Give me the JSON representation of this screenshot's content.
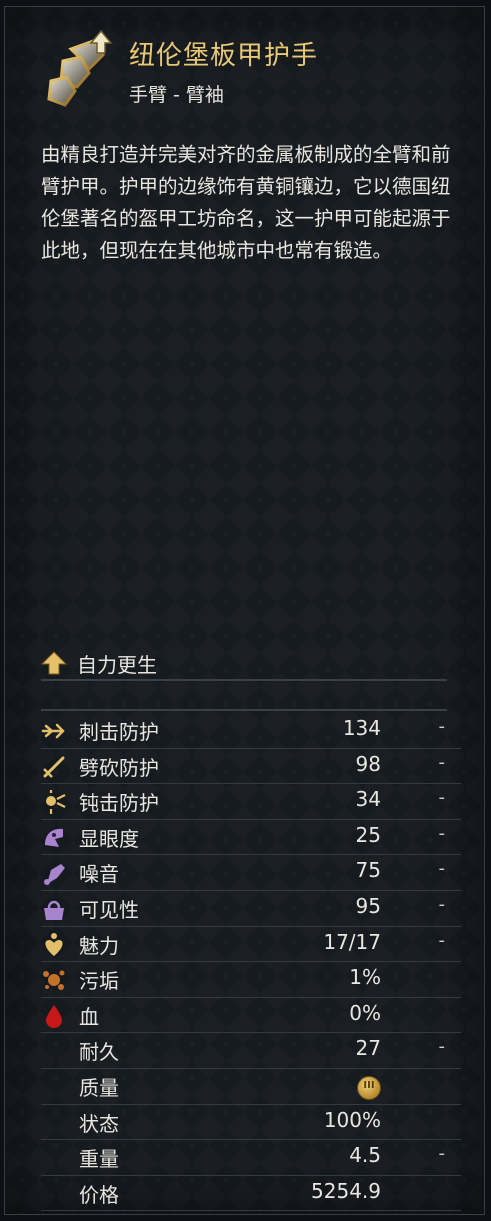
{
  "item": {
    "name": "纽伦堡板甲护手",
    "slot": "手臂 - 臂袖",
    "description": "由精良打造并完美对齐的金属板制成的全臂和前臂护甲。护甲的边缘饰有黄铜镶边，它以德国纽伦堡著名的盔甲工坊命名，这一护甲可能起源于此地，但现在在其他城市中也常有锻造。",
    "icon": "plate-gauntlet-icon"
  },
  "perk": {
    "label": "自力更生",
    "icon": "up-arrow-icon"
  },
  "stats": [
    {
      "icon": "stab-icon",
      "name": "刺击防护",
      "value": "134",
      "dash": "-"
    },
    {
      "icon": "slash-icon",
      "name": "劈砍防护",
      "value": "98",
      "dash": "-"
    },
    {
      "icon": "blunt-icon",
      "name": "钝击防护",
      "value": "34",
      "dash": "-"
    },
    {
      "icon": "conspicuousness-icon",
      "name": "显眼度",
      "value": "25",
      "dash": "-"
    },
    {
      "icon": "noise-icon",
      "name": "噪音",
      "value": "75",
      "dash": "-"
    },
    {
      "icon": "visibility-icon",
      "name": "可见性",
      "value": "95",
      "dash": "-"
    },
    {
      "icon": "charisma-icon",
      "name": "魅力",
      "value": "17/17",
      "dash": "-"
    },
    {
      "icon": "dirt-icon",
      "name": "污垢",
      "value": "1%",
      "dash": ""
    },
    {
      "icon": "blood-icon",
      "name": "血",
      "value": "0%",
      "dash": ""
    },
    {
      "icon": "",
      "name": "耐久",
      "value": "27",
      "dash": "-"
    },
    {
      "icon": "",
      "name": "质量",
      "value": "",
      "dash": "",
      "coin": "III"
    },
    {
      "icon": "",
      "name": "状态",
      "value": "100%",
      "dash": ""
    },
    {
      "icon": "",
      "name": "重量",
      "value": "4.5",
      "dash": "-"
    },
    {
      "icon": "",
      "name": "价格",
      "value": "5254.9",
      "dash": ""
    }
  ],
  "colors": {
    "title": "#e8c874",
    "text": "#e9e6df",
    "panel": "#161b20"
  }
}
